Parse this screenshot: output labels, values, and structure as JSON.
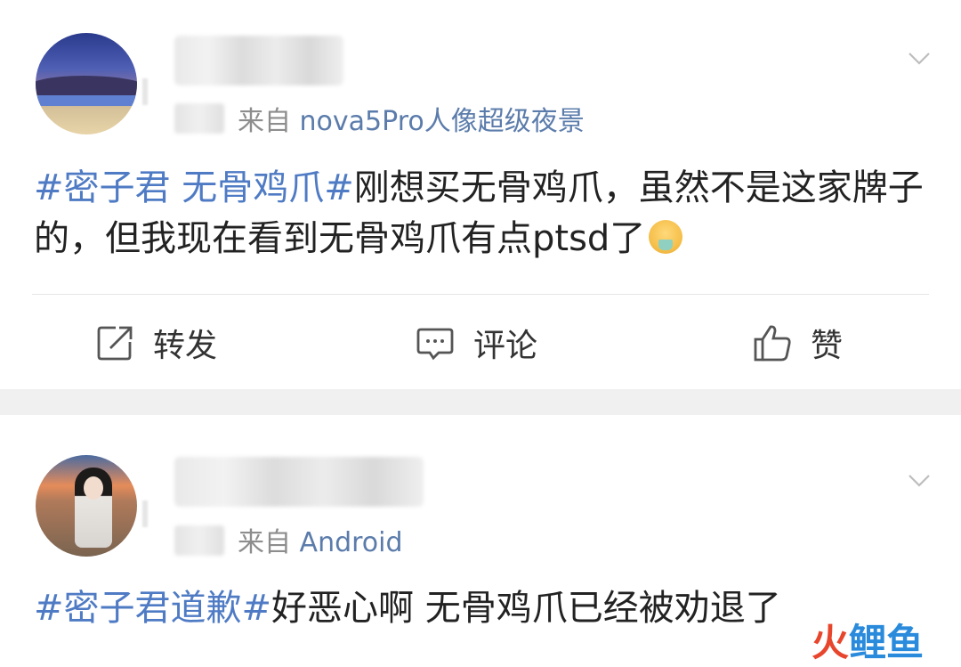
{
  "posts": [
    {
      "source_prefix": "来自",
      "source_device": "nova5Pro人像超级夜景",
      "content": {
        "tag": "#密子君 无骨鸡爪#",
        "text": "刚想买无骨鸡爪，虽然不是这家牌子的，但我现在看到无骨鸡爪有点ptsd了"
      },
      "emoji": "vomit-face-emoji",
      "actions": [
        {
          "label": "转发",
          "icon": "repost-icon"
        },
        {
          "label": "评论",
          "icon": "comment-icon"
        },
        {
          "label": "赞",
          "icon": "like-icon"
        }
      ]
    },
    {
      "source_prefix": "来自",
      "source_device": "Android",
      "content": {
        "tag": "#密子君道歉#",
        "text": "好恶心啊 无骨鸡爪已经被劝退了"
      }
    }
  ],
  "watermark": {
    "part1": "火",
    "part2": "鲤鱼"
  },
  "colors": {
    "tag": "#4f7bc4",
    "device": "#5b7cab",
    "muted": "#8d8d8d"
  }
}
